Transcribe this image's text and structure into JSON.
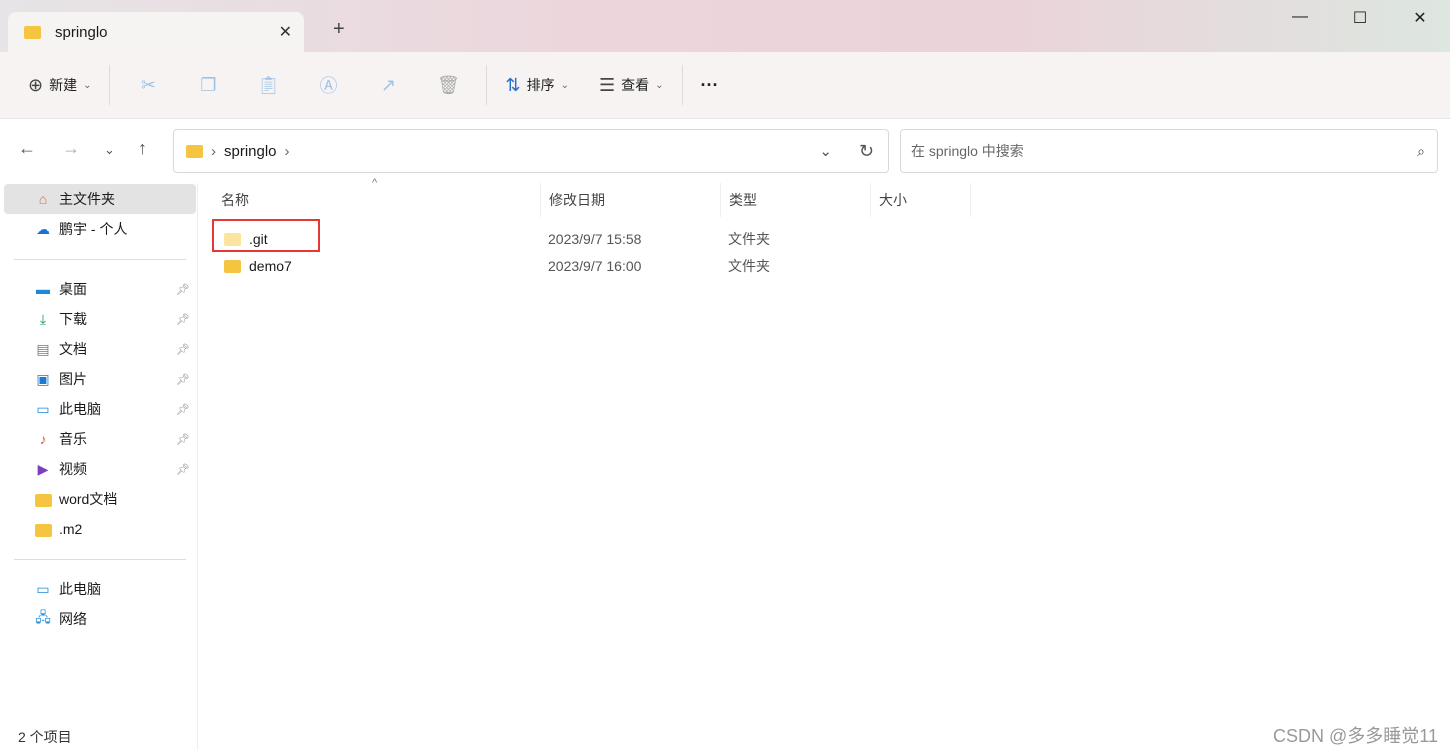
{
  "window": {
    "tab_title": "springlo",
    "close": "✕",
    "new_tab": "+",
    "min": "—",
    "max": "☐",
    "close_win": "✕"
  },
  "toolbar": {
    "new": "新建",
    "sort": "排序",
    "view": "查看",
    "more": "···"
  },
  "nav": {
    "path": "springlo",
    "search_placeholder": "在 springlo 中搜索"
  },
  "sidebar": {
    "top": [
      {
        "label": "主文件夹"
      },
      {
        "label": "鹏宇 - 个人"
      }
    ],
    "pinned": [
      {
        "label": "桌面"
      },
      {
        "label": "下载"
      },
      {
        "label": "文档"
      },
      {
        "label": "图片"
      },
      {
        "label": "此电脑"
      },
      {
        "label": "音乐"
      },
      {
        "label": "视频"
      },
      {
        "label": "word文档"
      },
      {
        "label": ".m2"
      }
    ],
    "bottom": [
      {
        "label": "此电脑"
      },
      {
        "label": "网络"
      }
    ]
  },
  "columns": {
    "name": "名称",
    "date": "修改日期",
    "type": "类型",
    "size": "大小"
  },
  "files": [
    {
      "name": ".git",
      "date": "2023/9/7 15:58",
      "type": "文件夹"
    },
    {
      "name": "demo7",
      "date": "2023/9/7 16:00",
      "type": "文件夹"
    }
  ],
  "status": "2 个项目",
  "watermark": "CSDN @多多睡觉11"
}
